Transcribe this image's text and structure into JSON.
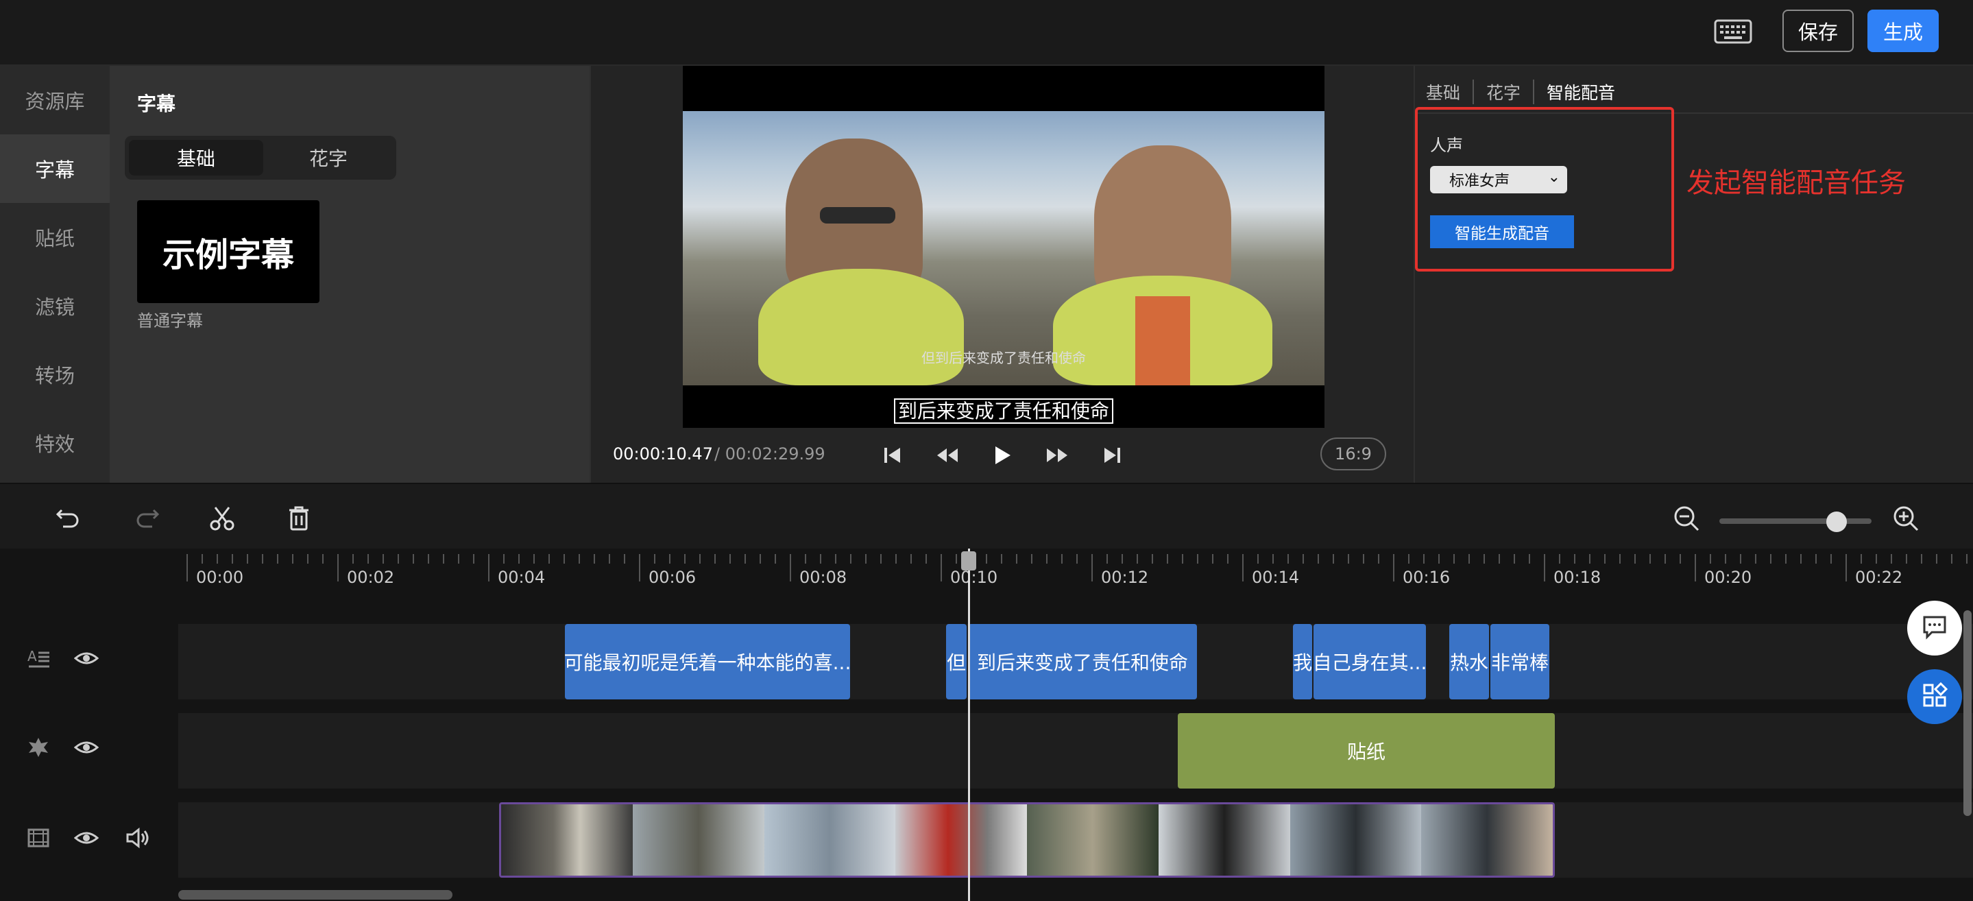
{
  "header": {
    "save_label": "保存",
    "generate_label": "生成",
    "icons": [
      "keyboard-icon"
    ]
  },
  "left_nav": {
    "items": [
      {
        "label": "资源库",
        "active": false
      },
      {
        "label": "字幕",
        "active": true
      },
      {
        "label": "贴纸",
        "active": false
      },
      {
        "label": "滤镜",
        "active": false
      },
      {
        "label": "转场",
        "active": false
      },
      {
        "label": "特效",
        "active": false
      }
    ]
  },
  "subtitle_panel": {
    "title": "字幕",
    "tabs": [
      {
        "label": "基础",
        "active": true
      },
      {
        "label": "花字",
        "active": false
      }
    ],
    "sample_text": "示例字幕",
    "sample_label": "普通字幕"
  },
  "preview": {
    "burned_subtitle": "但到后来变成了责任和使命",
    "live_subtitle": "到后来变成了责任和使命",
    "current_time": "00:00:10.47",
    "total_time": "/ 00:02:29.99",
    "aspect_ratio": "16:9",
    "controls": [
      "skip-back-icon",
      "rewind-icon",
      "play-icon",
      "fast-forward-icon",
      "skip-forward-icon"
    ]
  },
  "right_panel": {
    "tabs": [
      "基础",
      "花字",
      "智能配音"
    ],
    "active_tab": "智能配音",
    "voice_label": "人声",
    "voice_selected": "标准女声",
    "generate_voice_label": "智能生成配音",
    "annotation": "发起智能配音任务",
    "colors": {
      "annotation": "#e5322d",
      "primary": "#1e6fd9"
    }
  },
  "toolbar": {
    "icons": [
      "undo-icon",
      "redo-icon",
      "scissors-icon",
      "trash-icon",
      "zoom-out-icon",
      "zoom-in-icon"
    ],
    "zoom_level": 0.72
  },
  "timeline": {
    "ruler_labels": [
      "00:00",
      "00:02",
      "00:04",
      "00:06",
      "00:08",
      "00:10",
      "00:12",
      "00:14",
      "00:16",
      "00:18",
      "00:20",
      "00:22"
    ],
    "subtitle_clips": [
      "可能最初呢是凭着一种本能的喜...",
      "但",
      "到后来变成了责任和使命",
      "我",
      "自己身在其...",
      "热水",
      "非常棒"
    ],
    "sticker_clip": "贴纸",
    "track_icons": [
      "subtitle-track-icon",
      "sticker-track-icon",
      "video-track-icon"
    ],
    "colors": {
      "subtitle": "#3a73c6",
      "sticker": "#849b4b"
    }
  }
}
